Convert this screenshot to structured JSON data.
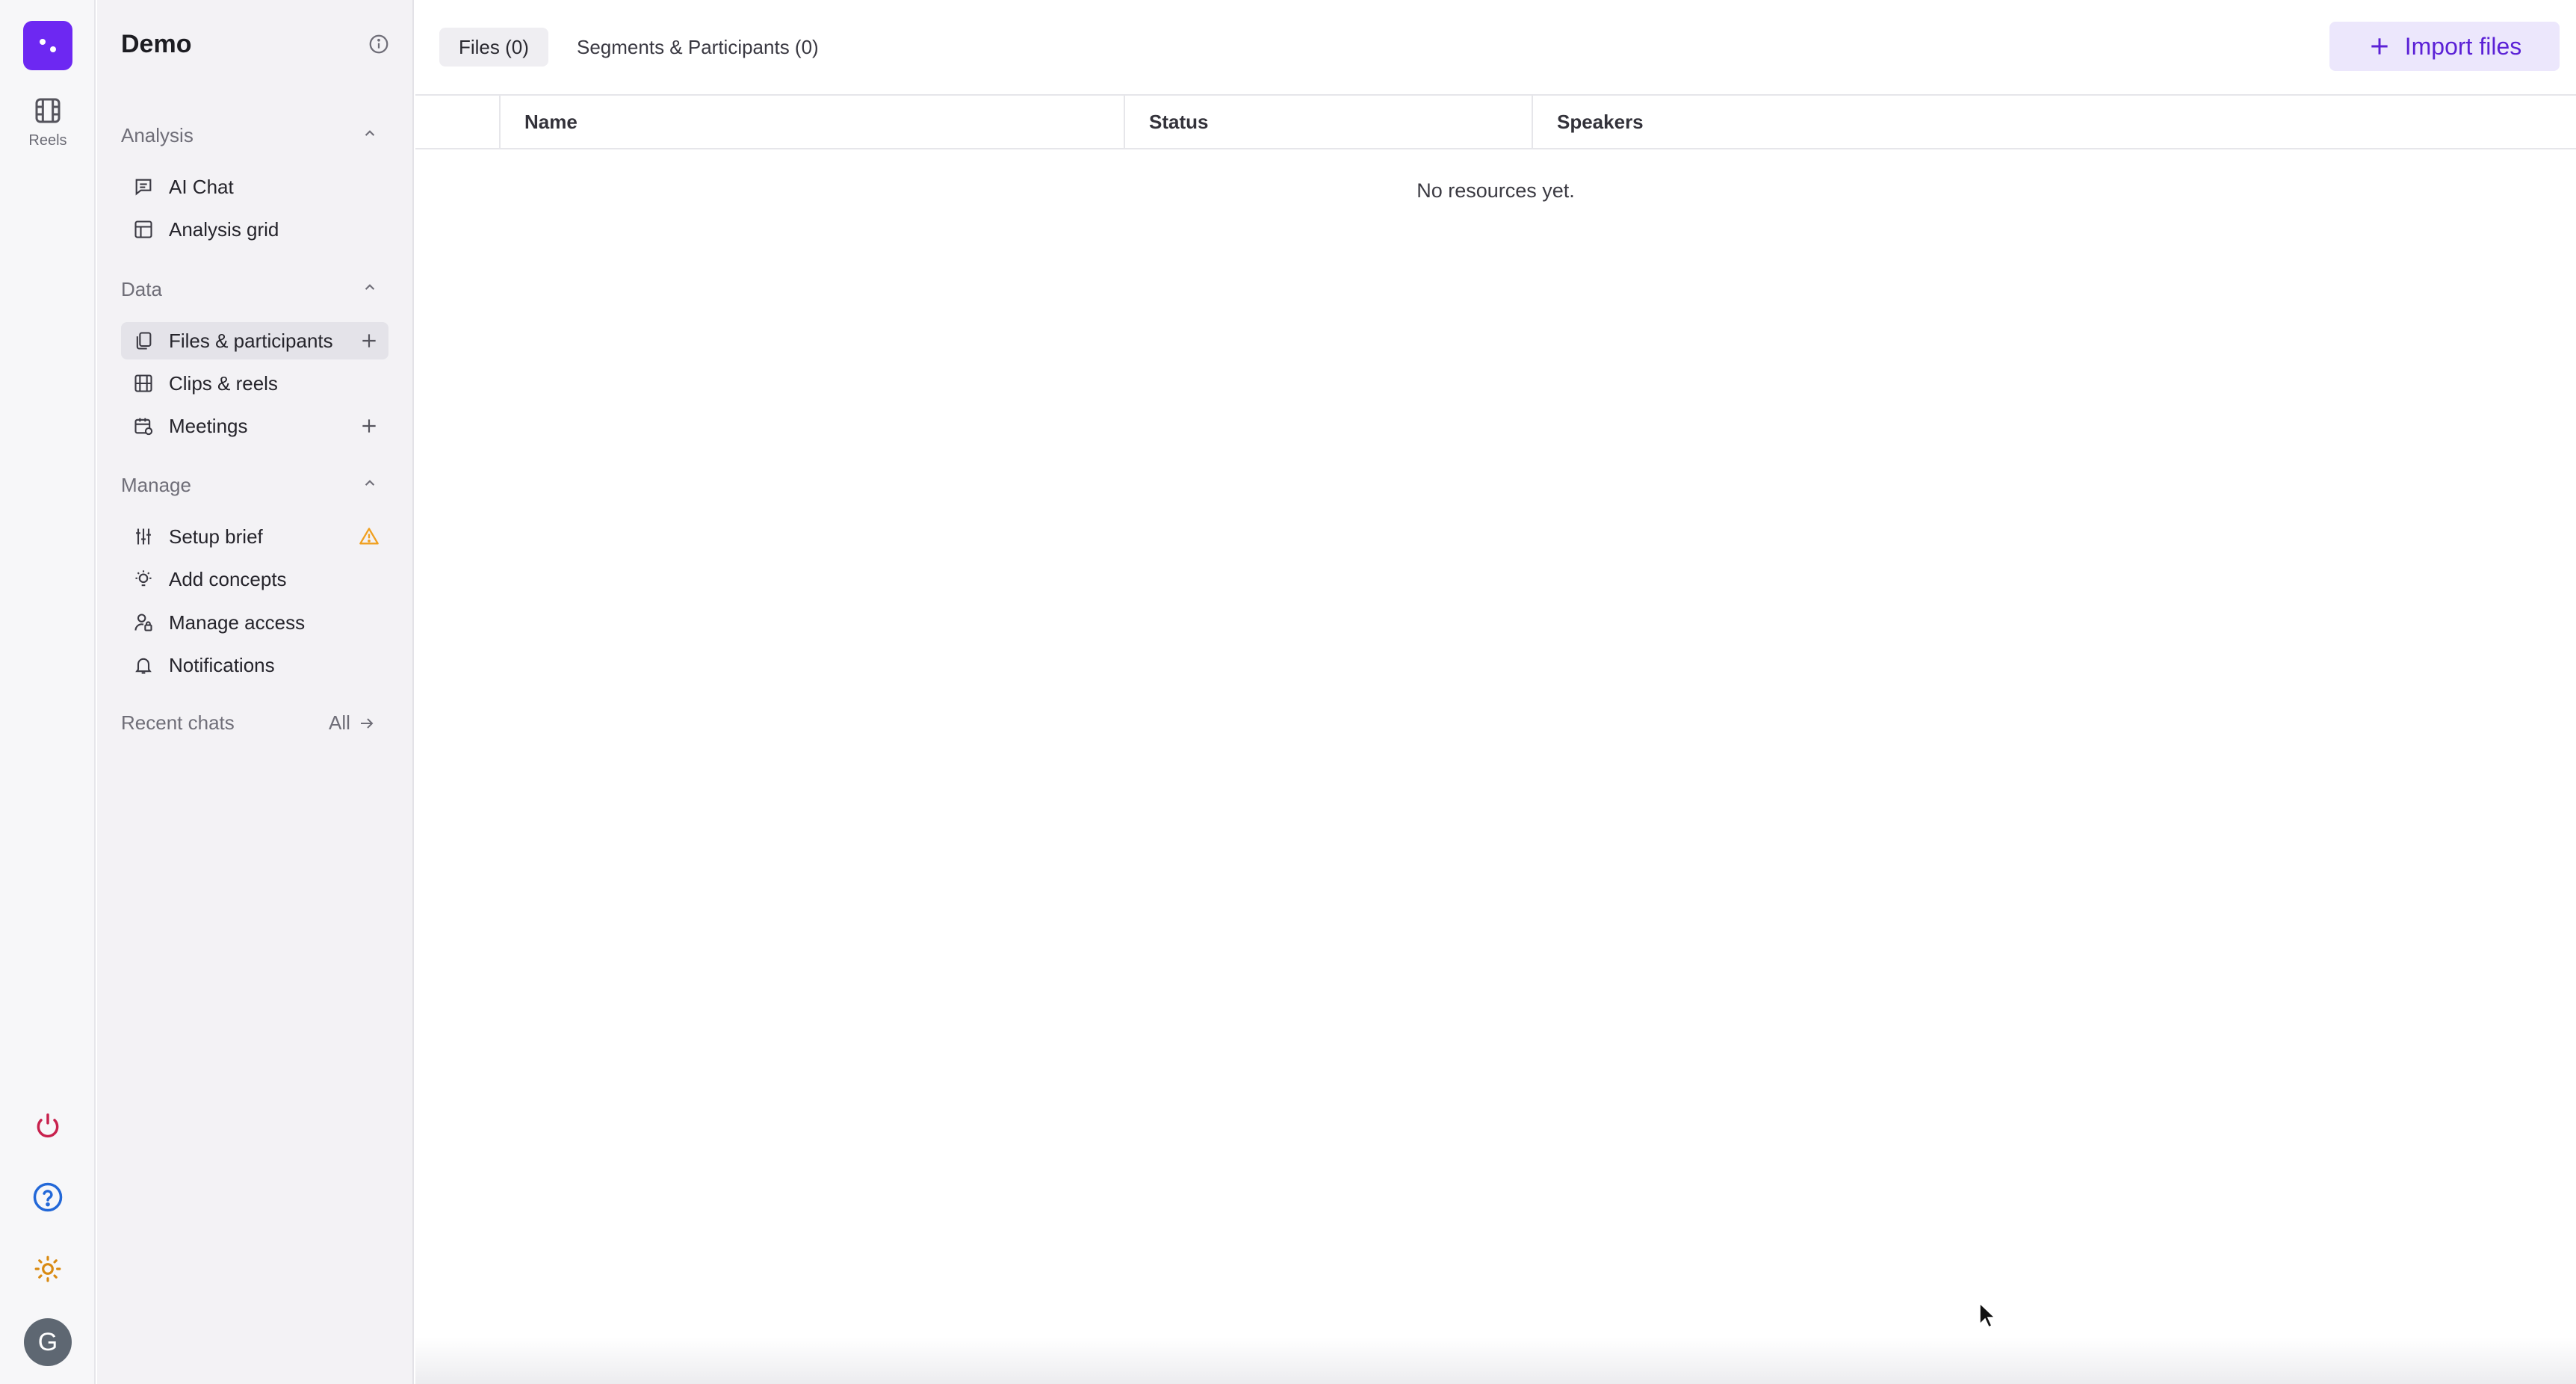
{
  "rail": {
    "items": [
      {
        "label": "Reels",
        "icon": "film-icon"
      }
    ],
    "bottom_icons": [
      "power-icon",
      "help-icon",
      "sun-icon"
    ],
    "avatar_initial": "G",
    "brand_color": "#6d28f2"
  },
  "sidebar": {
    "project_title": "Demo",
    "sections": [
      {
        "title": "Analysis",
        "items": [
          {
            "label": "AI Chat",
            "icon": "chat-icon"
          },
          {
            "label": "Analysis grid",
            "icon": "grid-icon"
          }
        ]
      },
      {
        "title": "Data",
        "items": [
          {
            "label": "Files & participants",
            "icon": "files-icon",
            "active": true
          },
          {
            "label": "Clips & reels",
            "icon": "film-icon"
          },
          {
            "label": "Meetings",
            "icon": "calendar-icon"
          }
        ]
      },
      {
        "title": "Manage",
        "items": [
          {
            "label": "Setup brief",
            "icon": "sliders-icon",
            "warning": true
          },
          {
            "label": "Add concepts",
            "icon": "lightbulb-icon"
          },
          {
            "label": "Manage access",
            "icon": "lock-user-icon"
          },
          {
            "label": "Notifications",
            "icon": "bell-icon"
          }
        ]
      }
    ],
    "recent_chats_label": "Recent chats",
    "recent_chats_all": "All"
  },
  "main": {
    "tabs": [
      {
        "label": "Files (0)",
        "active": true
      },
      {
        "label": "Segments & Participants (0)",
        "active": false
      }
    ],
    "import_button": "Import files",
    "table": {
      "columns": [
        "Name",
        "Status",
        "Speakers"
      ],
      "empty_message": "No resources yet."
    }
  },
  "colors": {
    "accent": "#5b21d6",
    "warning": "#f0a020"
  }
}
